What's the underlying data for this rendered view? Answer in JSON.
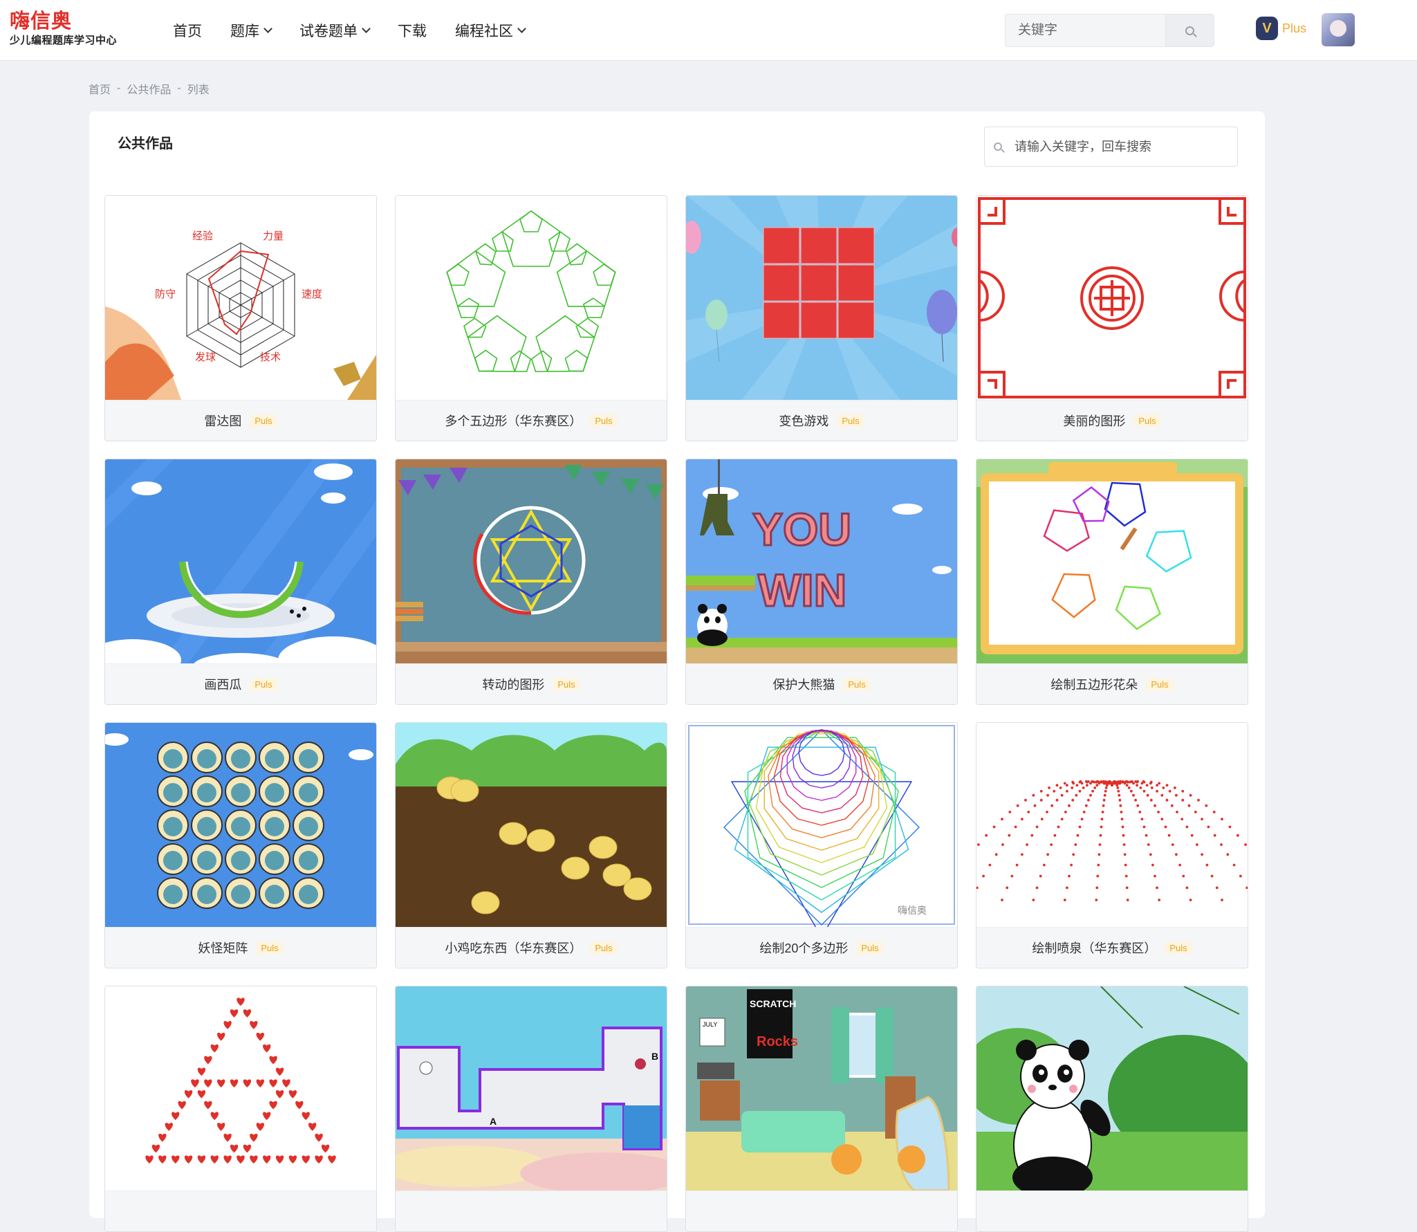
{
  "header": {
    "logo_name": "嗨信奥",
    "logo_tagline": "少儿编程题库学习中心",
    "nav": [
      {
        "label": "首页",
        "dropdown": false
      },
      {
        "label": "题库",
        "dropdown": true
      },
      {
        "label": "试卷题单",
        "dropdown": true
      },
      {
        "label": "下载",
        "dropdown": false
      },
      {
        "label": "编程社区",
        "dropdown": true
      }
    ],
    "search_placeholder": "关键字",
    "plus_label": "Plus"
  },
  "breadcrumb": [
    "首页",
    "公共作品",
    "列表"
  ],
  "panel": {
    "title": "公共作品",
    "search_placeholder": "请输入关键字，回车搜索"
  },
  "works": [
    {
      "title": "雷达图",
      "badge": "Puls"
    },
    {
      "title": "多个五边形（华东赛区）",
      "badge": "Puls"
    },
    {
      "title": "变色游戏",
      "badge": "Puls"
    },
    {
      "title": "美丽的图形",
      "badge": "Puls"
    },
    {
      "title": "画西瓜",
      "badge": "Puls"
    },
    {
      "title": "转动的图形",
      "badge": "Puls"
    },
    {
      "title": "保护大熊猫",
      "badge": "Puls"
    },
    {
      "title": "绘制五边形花朵",
      "badge": "Puls"
    },
    {
      "title": "妖怪矩阵",
      "badge": "Puls"
    },
    {
      "title": "小鸡吃东西（华东赛区）",
      "badge": "Puls"
    },
    {
      "title": "绘制20个多边形",
      "badge": "Puls"
    },
    {
      "title": "绘制喷泉（华东赛区）",
      "badge": "Puls"
    },
    {
      "title": "",
      "badge": ""
    },
    {
      "title": "",
      "badge": ""
    },
    {
      "title": "",
      "badge": ""
    },
    {
      "title": "",
      "badge": ""
    }
  ],
  "thumb_text": {
    "radar_labels": [
      "经验",
      "力量",
      "速度",
      "技术",
      "发球",
      "防守"
    ],
    "win_text": [
      "YOU",
      "WIN"
    ],
    "maze_labels": [
      "A",
      "B"
    ],
    "poster_text": [
      "SCRATCH",
      "Rocks"
    ],
    "calendar_label": "JULY",
    "watermark": "嗨信奥"
  },
  "colors": {
    "accent_red": "#e0302a",
    "logo_blue": "#3b5bdb",
    "plus_gold": "#f0a937",
    "badge_gold": "#e8a317"
  }
}
